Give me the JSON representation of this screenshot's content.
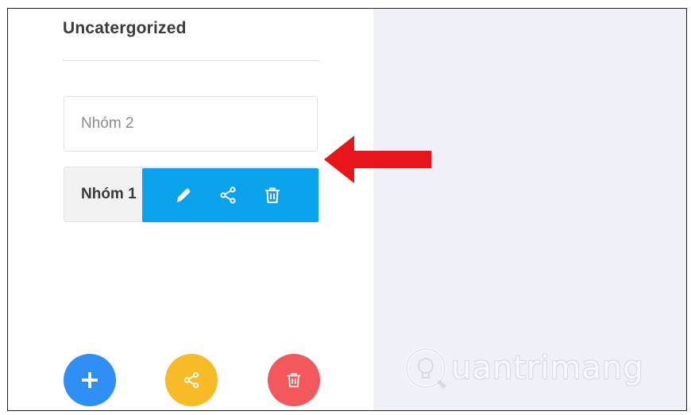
{
  "group": {
    "heading": "Uncatergorized"
  },
  "items": [
    {
      "label": "Nhóm 2"
    },
    {
      "label": "Nhóm 1"
    }
  ],
  "action_bar": {
    "icons": [
      "pencil-icon",
      "share-icon",
      "trash-icon"
    ]
  },
  "fabs": {
    "add_icon": "plus-icon",
    "share_icon": "share-icon",
    "delete_icon": "trash-icon",
    "colors": {
      "add": "#2f8ff5",
      "share": "#f7bb28",
      "delete": "#f3585d"
    }
  },
  "colors": {
    "action_bar": "#0aa2ea",
    "annotation_arrow": "#e8151b",
    "right_panel": "#eff0f8"
  },
  "watermark": {
    "text": "uantrimang"
  }
}
